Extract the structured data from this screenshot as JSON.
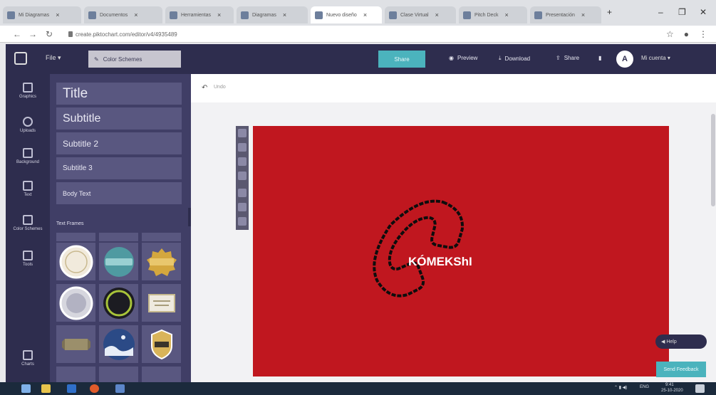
{
  "browser": {
    "tabs": [
      {
        "title": "Mi Diagramas",
        "active": false
      },
      {
        "title": "Documentos",
        "active": false
      },
      {
        "title": "Herramientas",
        "active": false
      },
      {
        "title": "Diagramas",
        "active": false
      },
      {
        "title": "Nuevo diseño",
        "active": true
      },
      {
        "title": "Clase Virtual",
        "active": false
      },
      {
        "title": "Pitch Deck",
        "active": false
      },
      {
        "title": "Presentación",
        "active": false
      }
    ],
    "url": "create.piktochart.com/editor/v4/4935489",
    "nav_back": "←",
    "nav_forward": "→",
    "reload": "↻",
    "win_min": "–",
    "win_max": "❐",
    "win_close": "✕",
    "star_icon": "☆",
    "menu_icon": "⋮"
  },
  "app": {
    "file_menu": "File ▾",
    "color_schemes_label": "Color Schemes",
    "share_label": "Share",
    "actions": [
      {
        "icon": "eye-icon",
        "glyph": "◉",
        "label": "Preview"
      },
      {
        "icon": "download-icon",
        "glyph": "⤓",
        "label": "Download"
      },
      {
        "icon": "share-icon",
        "glyph": "⇪",
        "label": "Share"
      }
    ],
    "lock_glyph": "🔒",
    "avatar_initial": "A",
    "user_name": "Mi cuenta ▾"
  },
  "rail": [
    {
      "label": "Graphics",
      "icon": "graphics-icon"
    },
    {
      "label": "Uploads",
      "icon": "uploads-icon"
    },
    {
      "label": "Background",
      "icon": "background-icon"
    },
    {
      "label": "Text",
      "icon": "text-icon"
    },
    {
      "label": "Color Schemes",
      "icon": "palette-icon"
    },
    {
      "label": "Tools",
      "icon": "tools-icon"
    },
    {
      "label": "Charts",
      "icon": "charts-icon"
    }
  ],
  "text_panel": {
    "tiles": [
      "Title",
      "Subtitle",
      "Subtitle 2",
      "Subtitle 3",
      "Body Text"
    ],
    "section_title": "Text Frames"
  },
  "canvas": {
    "background": "#c0171f",
    "logo_text": "KÓMEKShI",
    "undo_label": "Undo"
  },
  "help_pill": "◀ Help",
  "feedback_label": "Send Feedback",
  "taskbar": {
    "time": "9:41",
    "date": "25-10-2020",
    "lang": "ENG"
  }
}
